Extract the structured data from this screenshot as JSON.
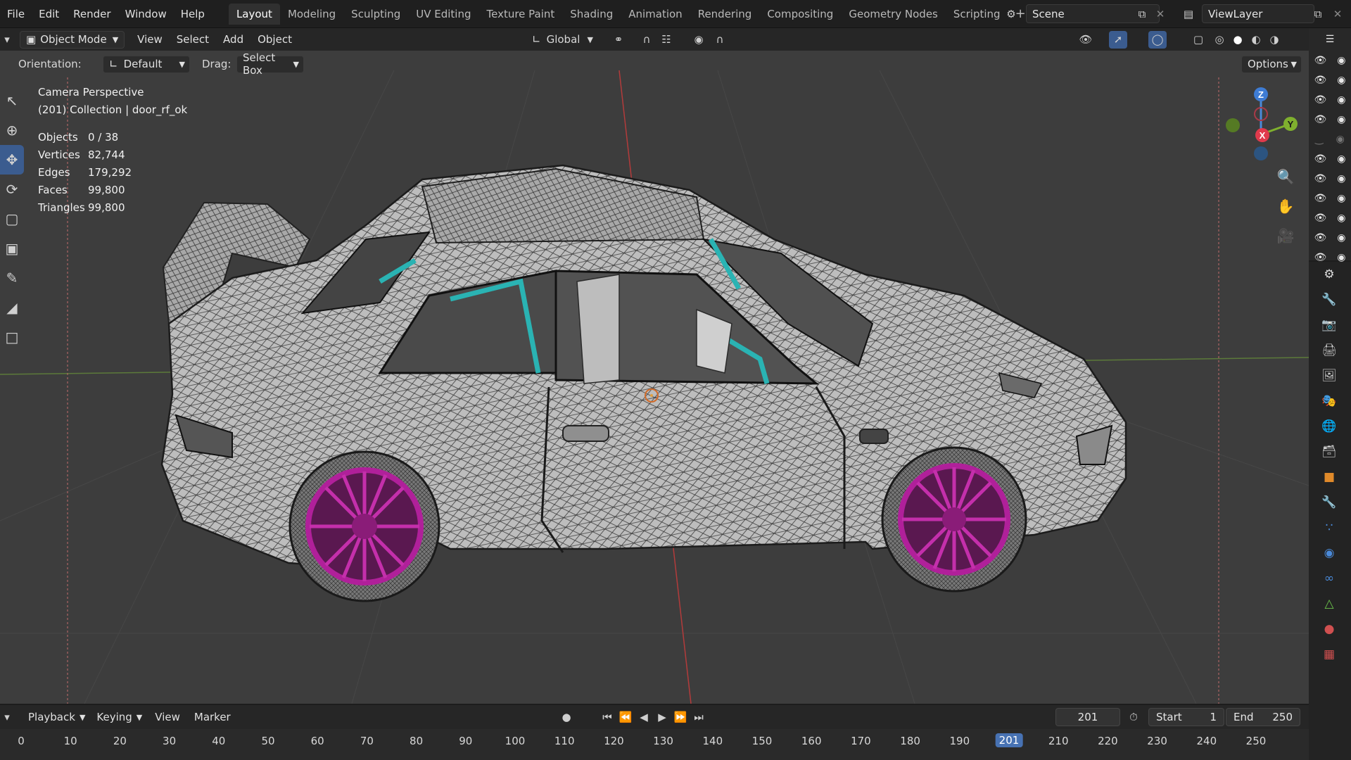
{
  "menu": [
    "File",
    "Edit",
    "Render",
    "Window",
    "Help"
  ],
  "workspaces": {
    "tabs": [
      "Layout",
      "Modeling",
      "Sculpting",
      "UV Editing",
      "Texture Paint",
      "Shading",
      "Animation",
      "Rendering",
      "Compositing",
      "Geometry Nodes",
      "Scripting"
    ],
    "active": "Layout",
    "add": "+"
  },
  "scene": {
    "name": "Scene",
    "view_layer": "ViewLayer"
  },
  "view3d_header": {
    "mode": "Object Mode",
    "menus": [
      "View",
      "Select",
      "Add",
      "Object"
    ],
    "transform_orientation": "Global"
  },
  "tool_settings": {
    "orientation_label": "Orientation:",
    "orientation_value": "Default",
    "drag_label": "Drag:",
    "drag_value": "Select Box",
    "options": "Options"
  },
  "viewport": {
    "view_name": "Camera Perspective",
    "collection_line": "(201) Collection | door_rf_ok",
    "colors": {
      "grid_x_axis": "#c43a3a",
      "grid_y_axis": "#6a9a3a",
      "wheel": "#b0209a",
      "cage": "#2ab3b3",
      "body": "#bdbdbd"
    }
  },
  "stats": [
    {
      "key": "Objects",
      "value": "0 / 38"
    },
    {
      "key": "Vertices",
      "value": "82,744"
    },
    {
      "key": "Edges",
      "value": "179,292"
    },
    {
      "key": "Faces",
      "value": "99,800"
    },
    {
      "key": "Triangles",
      "value": "99,800"
    }
  ],
  "gizmo": {
    "z": "Z",
    "y": "Y",
    "x": "X"
  },
  "timeline": {
    "menus": [
      "Playback",
      "Keying",
      "View",
      "Marker"
    ],
    "current_frame": "201",
    "start_label": "Start",
    "start": "1",
    "end_label": "End",
    "end": "250",
    "ticks": [
      "0",
      "10",
      "20",
      "30",
      "40",
      "50",
      "60",
      "70",
      "80",
      "90",
      "100",
      "110",
      "120",
      "130",
      "140",
      "150",
      "160",
      "170",
      "180",
      "190",
      "201",
      "210",
      "220",
      "230",
      "240",
      "250"
    ]
  }
}
